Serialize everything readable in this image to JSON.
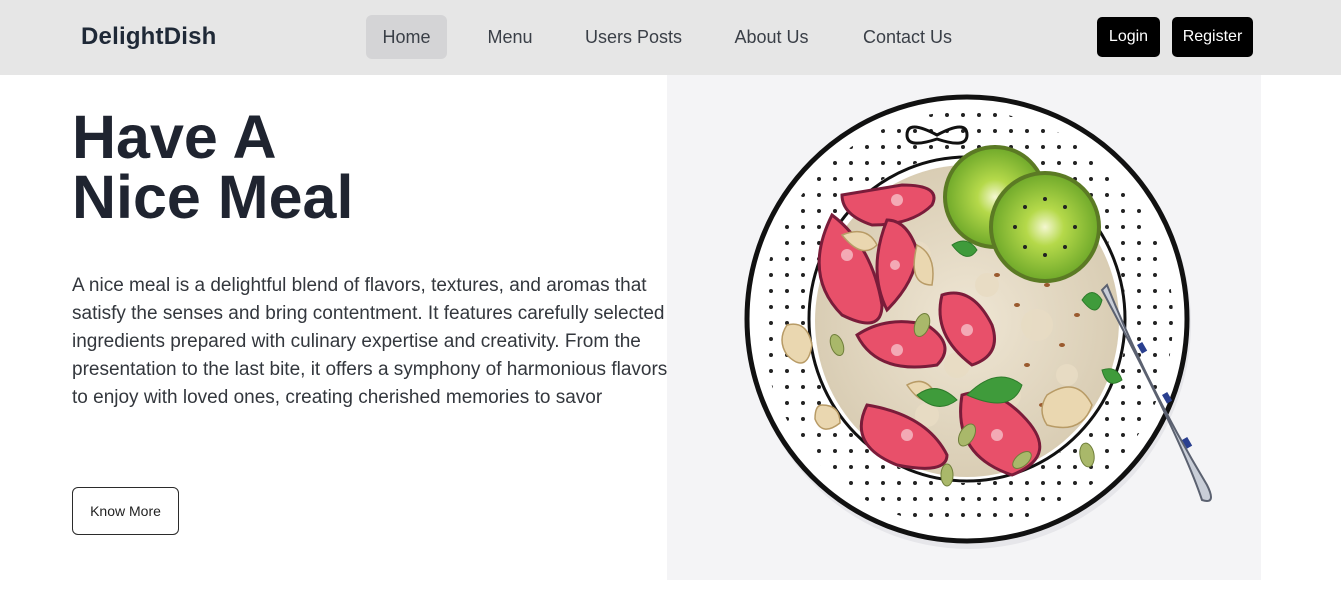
{
  "navbar": {
    "brand": "DelightDish",
    "links": [
      {
        "label": "Home",
        "active": true
      },
      {
        "label": "Menu",
        "active": false
      },
      {
        "label": "Users Posts",
        "active": false
      },
      {
        "label": "About Us",
        "active": false
      },
      {
        "label": "Contact Us",
        "active": false
      }
    ],
    "login_label": "Login",
    "register_label": "Register"
  },
  "hero": {
    "title_line1": "Have A",
    "title_line2": "Nice Meal",
    "description": "A nice meal is a delightful blend of flavors, textures, and aromas that satisfy the senses and bring contentment. It features carefully selected ingredients prepared with culinary expertise and creativity. From the presentation to the last bite, it offers a symphony of harmonious flavors to enjoy with loved ones, creating cherished memories to savor",
    "button_label": "Know More",
    "image_subject": "bowl-of-oatmeal-with-figs-kiwi-nuts"
  },
  "colors": {
    "navbar_bg": "#e6e6e6",
    "active_link_bg": "#d4d4d6",
    "button_dark": "#000000",
    "title_text": "#1f2430",
    "body_text": "#33373d"
  }
}
